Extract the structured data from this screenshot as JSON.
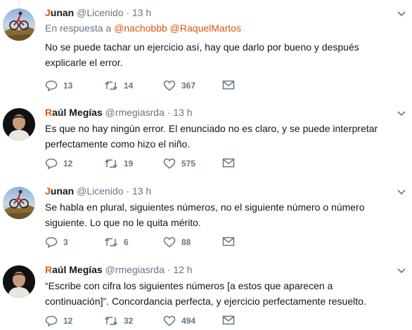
{
  "tweets": [
    {
      "first": "J",
      "rest": "unan",
      "handle": "@Licenido",
      "dot": "·",
      "time": "13 h",
      "reply_prefix": "En respuesta a ",
      "mentions": [
        "@nachobbb",
        "@RaquelMartos"
      ],
      "text": "No se puede tachar un ejercicio así, hay que darlo por bueno y después explicarle el error.",
      "replies": "13",
      "retweets": "14",
      "likes": "367",
      "avatar": "cyclist"
    },
    {
      "first": "R",
      "rest": "aúl Megías",
      "handle": "@rmegiasrda",
      "dot": "·",
      "time": "13 h",
      "text": "Es que no hay ningún error. El enunciado no es claro, y se puede interpretar perfectamente como hizo el niño.",
      "replies": "12",
      "retweets": "19",
      "likes": "575",
      "avatar": "person"
    },
    {
      "first": "J",
      "rest": "unan",
      "handle": "@Licenido",
      "dot": "·",
      "time": "13 h",
      "text": "Se habla en plural, siguientes números, no el siguiente número o número siguiente. Lo que no le quita mérito.",
      "replies": "3",
      "retweets": "6",
      "likes": "88",
      "avatar": "cyclist"
    },
    {
      "first": "R",
      "rest": "aúl Megías",
      "handle": "@rmegiasrda",
      "dot": "·",
      "time": "12 h",
      "text": "“Escribe con cifra los siguientes números [a estos que aparecen a continuación]”. Concordancia perfecta, y ejercicio perfectamente resuelto.",
      "replies": "12",
      "retweets": "32",
      "likes": "494",
      "avatar": "person"
    }
  ],
  "icons": {
    "reply": "reply-icon",
    "retweet": "retweet-icon",
    "like": "heart-icon",
    "dm": "envelope-icon",
    "more": "chevron-down-icon"
  },
  "colors": {
    "name_accent": "#d95e10",
    "mention": "#d9580f",
    "meta": "#657786",
    "text": "#14171a"
  }
}
